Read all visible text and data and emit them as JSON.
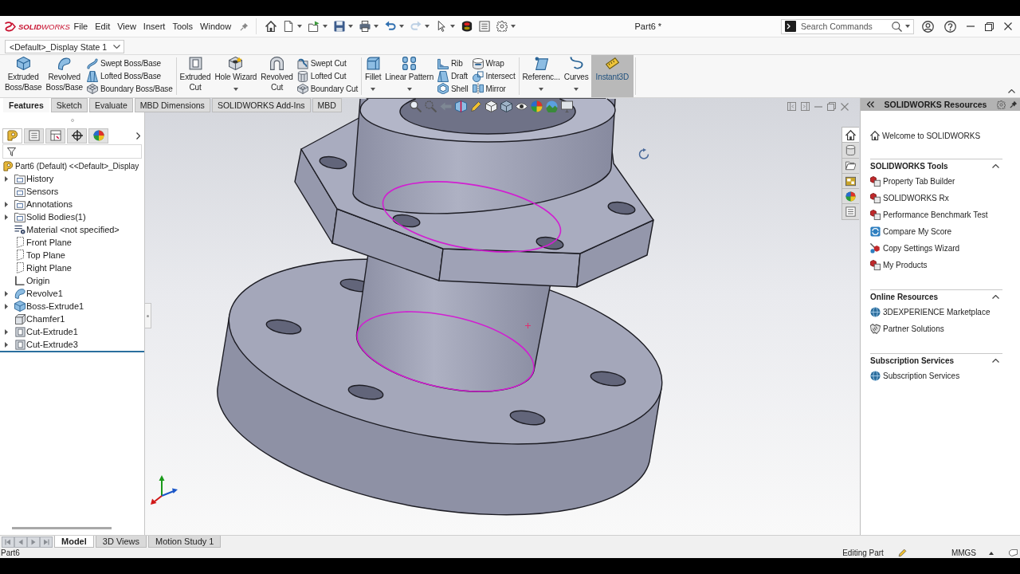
{
  "title_bar": {
    "logo": "**SOLID**WORKS",
    "menus": [
      "File",
      "Edit",
      "View",
      "Insert",
      "Tools",
      "Window"
    ],
    "quick_access": [
      {
        "dropdown": false,
        "disabled": false
      },
      {
        "dropdown": true,
        "disabled": false
      },
      {
        "dropdown": true,
        "disabled": false
      },
      {
        "dropdown": true,
        "disabled": false
      },
      {
        "dropdown": true,
        "disabled": false
      },
      {
        "dropdown": true,
        "disabled": false
      },
      {
        "dropdown": true,
        "disabled": true
      },
      {
        "dropdown": true,
        "disabled": false
      },
      {
        "dropdown": false,
        "disabled": false
      },
      {
        "dropdown": false,
        "disabled": false
      },
      {
        "dropdown": true,
        "disabled": false
      }
    ],
    "document_title": "Part6 *",
    "search": {
      "placeholder": "Search Commands"
    }
  },
  "display_state": {
    "value": "<Default>_Display State 1"
  },
  "ribbon": {
    "groups": [
      {
        "columns": [
          {
            "kind": "large",
            "label": "Extruded Boss/Base",
            "dropdown": false,
            "on": false
          },
          {
            "kind": "large",
            "label": "Revolved Boss/Base",
            "dropdown": false,
            "on": false
          },
          {
            "kind": "stack",
            "items": [
              "Swept Boss/Base",
              "Lofted Boss/Base",
              "Boundary Boss/Base"
            ]
          }
        ]
      },
      {
        "columns": [
          {
            "kind": "large",
            "label": "Extruded Cut",
            "dropdown": false,
            "on": false
          },
          {
            "kind": "large",
            "label": "Hole Wizard",
            "dropdown": true,
            "on": false
          },
          {
            "kind": "large",
            "label": "Revolved Cut",
            "dropdown": false,
            "on": false
          },
          {
            "kind": "stack",
            "items": [
              "Swept Cut",
              "Lofted Cut",
              "Boundary Cut"
            ]
          }
        ]
      },
      {
        "columns": [
          {
            "kind": "large",
            "label": "Fillet",
            "dropdown": true,
            "on": false
          },
          {
            "kind": "large",
            "label": "Linear Pattern",
            "dropdown": true,
            "on": false
          },
          {
            "kind": "stack",
            "items": [
              "Rib",
              "Draft",
              "Shell"
            ]
          },
          {
            "kind": "stack",
            "items": [
              "Wrap",
              "Intersect",
              "Mirror"
            ]
          }
        ]
      },
      {
        "columns": [
          {
            "kind": "large",
            "label": "Referenc...",
            "dropdown": true,
            "on": false
          },
          {
            "kind": "large",
            "label": "Curves",
            "dropdown": true,
            "on": false
          },
          {
            "kind": "large",
            "label": "Instant3D",
            "dropdown": false,
            "on": true
          }
        ]
      }
    ]
  },
  "command_tabs": [
    {
      "label": "Features",
      "selected": true
    },
    {
      "label": "Sketch",
      "selected": false
    },
    {
      "label": "Evaluate",
      "selected": false
    },
    {
      "label": "MBD Dimensions",
      "selected": false
    },
    {
      "label": "SOLIDWORKS Add-Ins",
      "selected": false
    },
    {
      "label": "MBD",
      "selected": false
    }
  ],
  "feature_manager": {
    "tabs": [
      {
        "selected": true
      },
      {
        "selected": false
      },
      {
        "selected": false
      },
      {
        "selected": false
      },
      {
        "selected": false
      }
    ],
    "tree": {
      "label": "Part6 (Default) <<Default>_Display",
      "children": [
        {
          "label": "History",
          "kind": "folder",
          "expandable": true
        },
        {
          "label": "Sensors",
          "kind": "folder",
          "expandable": false
        },
        {
          "label": "Annotations",
          "kind": "folder",
          "expandable": true
        },
        {
          "label": "Solid Bodies(1)",
          "kind": "folder",
          "expandable": true
        },
        {
          "label": "Material <not specified>",
          "kind": "material",
          "expandable": false
        },
        {
          "label": "Front Plane",
          "kind": "plane",
          "expandable": false
        },
        {
          "label": "Top Plane",
          "kind": "plane",
          "expandable": false
        },
        {
          "label": "Right Plane",
          "kind": "plane",
          "expandable": false
        },
        {
          "label": "Origin",
          "kind": "origin",
          "expandable": false
        },
        {
          "label": "Revolve1",
          "kind": "revolve",
          "expandable": true
        },
        {
          "label": "Boss-Extrude1",
          "kind": "extrude",
          "expandable": true
        },
        {
          "label": "Chamfer1",
          "kind": "chamfer",
          "expandable": false
        },
        {
          "label": "Cut-Extrude1",
          "kind": "cut",
          "expandable": true
        },
        {
          "label": "Cut-Extrude3",
          "kind": "cut",
          "expandable": true
        }
      ]
    }
  },
  "task_pane": {
    "tabs": [
      {
        "selected": true
      },
      {
        "selected": false
      },
      {
        "selected": false
      },
      {
        "selected": false
      },
      {
        "selected": false
      },
      {
        "selected": false
      }
    ],
    "title": "SOLIDWORKS Resources",
    "welcome": "Welcome to SOLIDWORKS",
    "sections": [
      {
        "title": "SOLIDWORKS Tools",
        "expanded": true,
        "items": [
          "Property Tab Builder",
          "SOLIDWORKS Rx",
          "Performance Benchmark Test",
          "Compare My Score",
          "Copy Settings Wizard",
          "My Products"
        ]
      },
      {
        "title": "Online Resources",
        "expanded": true,
        "items": [
          "3DEXPERIENCE Marketplace",
          "Partner Solutions"
        ]
      },
      {
        "title": "Subscription Services",
        "expanded": true,
        "items": [
          "Subscription Services"
        ]
      }
    ]
  },
  "bottom_tabs": [
    {
      "label": "Model",
      "selected": true
    },
    {
      "label": "3D Views",
      "selected": false
    },
    {
      "label": "Motion Study 1",
      "selected": false
    }
  ],
  "status_bar": {
    "document": "Part6",
    "mode": "Editing Part",
    "units": "MMGS"
  }
}
